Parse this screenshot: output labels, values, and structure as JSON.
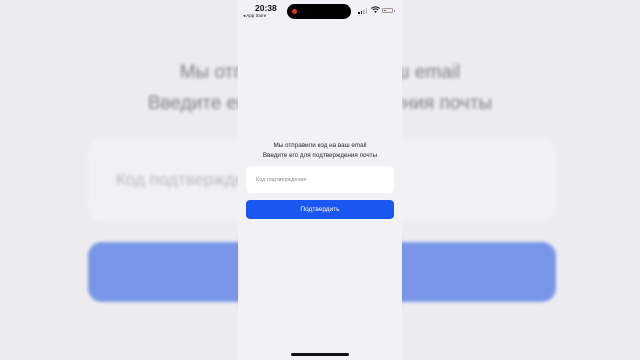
{
  "status_bar": {
    "time": "20:38",
    "back_app": "◂ App Store",
    "icons": [
      "screen-recording-icon",
      "cellular-signal-icon",
      "wifi-icon",
      "battery-low-icon"
    ]
  },
  "verification": {
    "message_line1": "Мы отправили код на ваш email",
    "message_line2": "Введите его для подтверждения почты",
    "code_placeholder": "Код подтверждения",
    "confirm_label": "Подтвердить"
  },
  "background": {
    "line1": "Мы отправили код на ваш email",
    "line2": "Введите его для подтверждения почты",
    "input_text": "Код подтверждения"
  },
  "colors": {
    "accent": "#1a56f0",
    "screen_bg": "#f2f2f6",
    "battery_low": "#e53323"
  }
}
